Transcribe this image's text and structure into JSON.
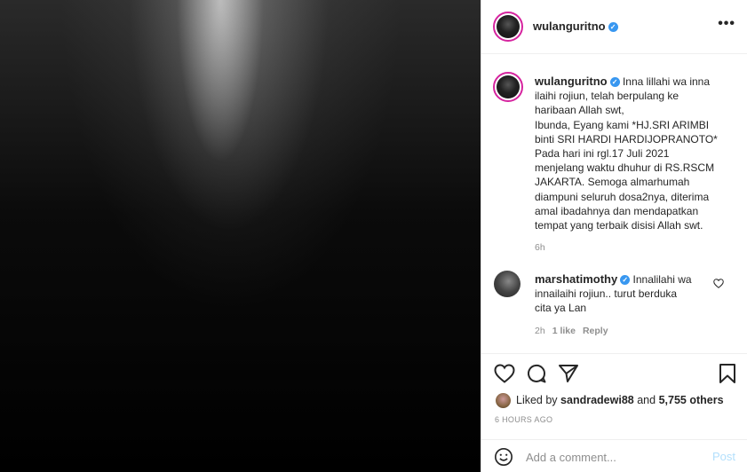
{
  "post": {
    "author": "wulanguritno",
    "caption_lines": [
      "Inna lillahi wa inna",
      "ilaihi rojiun, telah berpulang ke",
      "haribaan Allah swt,",
      "Ibunda, Eyang kami *HJ.SRI ARIMBI",
      "binti SRI HARDI HARDIJOPRANOTO*",
      "Pada hari ini rgl.17 Juli 2021",
      "menjelang waktu dhuhur di RS.RSCM",
      "JAKARTA. Semoga almarhumah",
      "diampuni seluruh dosa2nya, diterima",
      "amal ibadahnya dan mendapatkan",
      "tempat yang terbaik disisi Allah swt."
    ],
    "caption_age": "6h"
  },
  "comment": {
    "author": "marshatimothy",
    "text_lines": [
      "Innalilahi wa",
      "innailaihi rojiun.. turut berduka",
      "cita ya Lan"
    ],
    "age": "2h",
    "likes": "1 like",
    "reply": "Reply"
  },
  "likes": {
    "prefix": "Liked by",
    "user": "sandradewi88",
    "and": "and",
    "count": "5,755 others"
  },
  "timestamp": "6 HOURS AGO",
  "comment_box": {
    "placeholder": "Add a comment...",
    "post_label": "Post"
  },
  "icons": {
    "more": "more-options-icon",
    "verified": "verified-badge-icon",
    "like": "heart-icon",
    "comment": "comment-icon",
    "share": "share-icon",
    "save": "bookmark-icon",
    "emoji": "emoji-icon"
  },
  "colors": {
    "verified": "#3897f0",
    "story_ring": "#d6249f",
    "post_disabled": "#b2dffc"
  }
}
